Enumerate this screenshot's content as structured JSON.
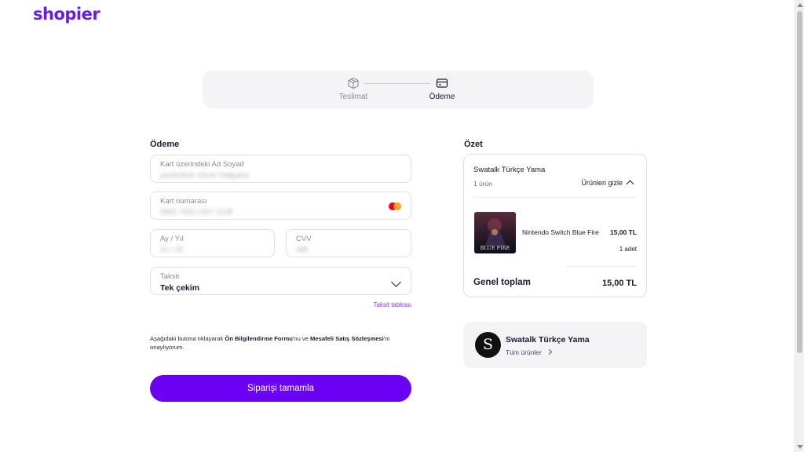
{
  "brand": {
    "logo": "shopier",
    "accent": "#6a00f4"
  },
  "stepper": {
    "steps": [
      {
        "label": "Teslimat",
        "icon": "box-icon",
        "active": false
      },
      {
        "label": "Ödeme",
        "icon": "credit-card-icon",
        "active": true
      }
    ]
  },
  "payment": {
    "title": "Ödeme",
    "name_field": {
      "label": "Kart üzerindeki Ad Soyad",
      "value": "pazardesk Göcer Dağçana"
    },
    "card_field": {
      "label": "Kart numarası",
      "value": "5892 7932 0207 3148",
      "brand_icon": "mastercard-icon"
    },
    "expiry_field": {
      "label": "Ay / Yıl",
      "value": "10 / 29"
    },
    "cvv_field": {
      "label": "CVV",
      "value": "485"
    },
    "installment_field": {
      "label": "Taksit",
      "value": "Tek çekim"
    },
    "installment_link": "Taksit tablosu",
    "consent": {
      "prefix": "Aşağıdaki butona tıklayarak ",
      "link1": "Ön Bilgilendirme Formu",
      "middle": "'nu ve ",
      "link2": "Mesafeli Satış Sözleşmesi",
      "suffix": "'ni onaylıyorum."
    },
    "submit_label": "Siparişi tamamla"
  },
  "summary": {
    "title": "Özet",
    "shop_name": "Swatalk Türkçe Yama",
    "item_count": "1 ürün",
    "toggle_label": "Ürünleri gizle",
    "product": {
      "name": "Nintendo Switch Blue Fire",
      "price": "15,00 TL",
      "qty": "1 adet",
      "thumb_caption": "BLUE FIRE"
    },
    "total_label": "Genel toplam",
    "total_value": "15,00 TL"
  },
  "store": {
    "avatar_letter": "S",
    "name": "Swatalk Türkçe Yama",
    "link_label": "Tüm ürünler"
  }
}
